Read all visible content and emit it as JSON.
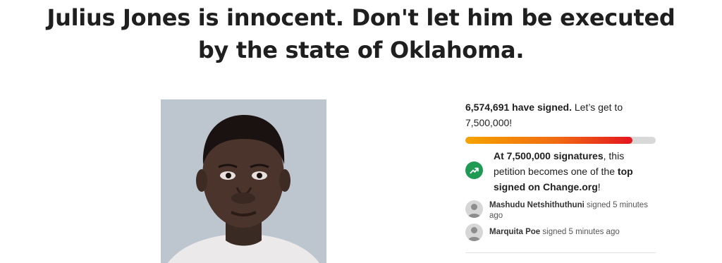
{
  "petition": {
    "title_line1": "Julius Jones is innocent. Don't let him be executed",
    "title_line2": "by the state of Oklahoma."
  },
  "signatures": {
    "count_label": "6,574,691 have signed.",
    "goal_text": "Let’s get to 7,500,000!",
    "progress_fraction": 0.8766
  },
  "milestone": {
    "icon": "trending-up-icon",
    "bold_target": "At 7,500,000 signatures",
    "text_middle": ", this petition becomes one of the ",
    "bold_top": "top signed on Change.org",
    "text_end": "!"
  },
  "recent_signers": [
    {
      "name": "Mashudu Netshithuthuni",
      "action": "signed 5 minutes ago"
    },
    {
      "name": "Marquita Poe",
      "action": "signed 5 minutes ago"
    }
  ],
  "colors": {
    "progress_start": "#f5a300",
    "progress_end": "#e3151e",
    "milestone_badge": "#1e9a55"
  }
}
